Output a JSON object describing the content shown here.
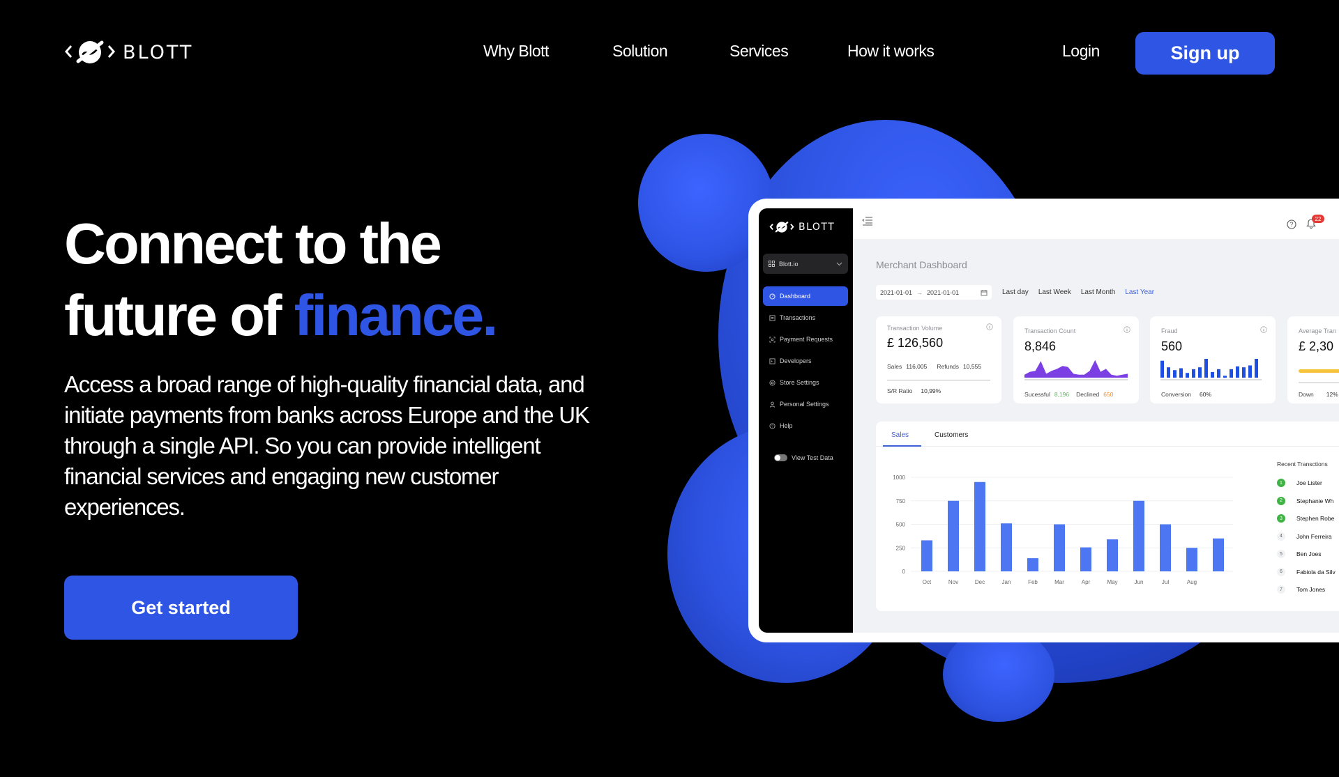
{
  "brand": {
    "name": "BLOTT",
    "accent": "#2f55e4"
  },
  "nav": {
    "links": [
      "Why Blott",
      "Solution",
      "Services",
      "How it works"
    ],
    "login": "Login",
    "signup": "Sign up"
  },
  "hero": {
    "title_line1": "Connect to the",
    "title_line2_plain": "future of ",
    "title_line2_accent": "finance.",
    "subtitle": "Access a broad range of high-quality financial data, and initiate payments from banks across Europe and the UK through a single API. So you can provide intelligent financial services and engaging new customer experiences.",
    "cta": "Get started"
  },
  "dashboard": {
    "brand": "BLOTT",
    "org": "Blott.io",
    "sidebar": [
      {
        "label": "Dashboard",
        "icon": "gauge-icon",
        "active": true
      },
      {
        "label": "Transactions",
        "icon": "receipt-icon",
        "active": false
      },
      {
        "label": "Payment Requests",
        "icon": "scan-icon",
        "active": false
      },
      {
        "label": "Developers",
        "icon": "terminal-icon",
        "active": false
      },
      {
        "label": "Store Settings",
        "icon": "settings-icon",
        "active": false
      },
      {
        "label": "Personal Settings",
        "icon": "user-icon",
        "active": false
      },
      {
        "label": "Help",
        "icon": "help-icon",
        "active": false
      }
    ],
    "test_toggle": "View Test Data",
    "notifications": "22",
    "page_title": "Merchant Dashboard",
    "date_from": "2021-01-01",
    "date_arrow": "→",
    "date_to": "2021-01-01",
    "range_options": [
      "Last day",
      "Last Week",
      "Last Month",
      "Last Year"
    ],
    "range_selected": "Last Year",
    "cards": {
      "volume": {
        "title": "Transaction Volume",
        "value": "£ 126,560",
        "sales_label": "Sales",
        "sales": "116,005",
        "refunds_label": "Refunds",
        "refunds": "10,555",
        "ratio_label": "S/R Ratio",
        "ratio": "10,99%"
      },
      "count": {
        "title": "Transaction Count",
        "value": "8,846",
        "success_label": "Sucessful",
        "success": "8,196",
        "declined_label": "Declined",
        "declined": "650"
      },
      "fraud": {
        "title": "Fraud",
        "value": "560",
        "conversion_label": "Conversion",
        "conversion": "60%",
        "bars": [
          0.9,
          0.55,
          0.4,
          0.5,
          0.25,
          0.45,
          0.55,
          1.0,
          0.3,
          0.45,
          0.1,
          0.45,
          0.6,
          0.55,
          0.65,
          1.0
        ]
      },
      "average": {
        "title": "Average Tran",
        "value": "£ 2,30",
        "down_label": "Down",
        "down": "12%",
        "progress": 0.7,
        "bar_color": "#f5c43a"
      }
    },
    "tabs": [
      "Sales",
      "Customers"
    ],
    "active_tab": "Sales",
    "recent_title": "Recent Transctions",
    "recent": [
      {
        "rank": "1",
        "name": "Joe Lister",
        "top": true
      },
      {
        "rank": "2",
        "name": "Stephanie Wh",
        "top": true
      },
      {
        "rank": "3",
        "name": "Stephen Robe",
        "top": true
      },
      {
        "rank": "4",
        "name": "John Ferreira",
        "top": false
      },
      {
        "rank": "5",
        "name": "Ben Joes",
        "top": false
      },
      {
        "rank": "6",
        "name": "Fabiola da Silv",
        "top": false
      },
      {
        "rank": "7",
        "name": "Tom Jones",
        "top": false
      }
    ]
  },
  "chart_data": {
    "type": "bar",
    "title": "Sales",
    "categories": [
      "Oct",
      "Nov",
      "Dec",
      "Jan",
      "Feb",
      "Mar",
      "Apr",
      "May",
      "Jun",
      "Jul",
      "Aug",
      ""
    ],
    "values": [
      330,
      750,
      950,
      510,
      140,
      500,
      255,
      340,
      750,
      500,
      250,
      350
    ],
    "yticks": [
      0,
      250,
      500,
      750,
      1000
    ],
    "ylim": [
      0,
      1000
    ],
    "xlabel": "",
    "ylabel": "",
    "grid": true,
    "bar_color": "#4d77f2"
  },
  "sparkline": {
    "color": "#7b3fe4",
    "values": [
      0.15,
      0.3,
      0.35,
      0.85,
      0.2,
      0.35,
      0.45,
      0.6,
      0.55,
      0.2,
      0.15,
      0.15,
      0.35,
      0.9,
      0.3,
      0.45,
      0.15,
      0.1,
      0.15,
      0.2
    ]
  }
}
